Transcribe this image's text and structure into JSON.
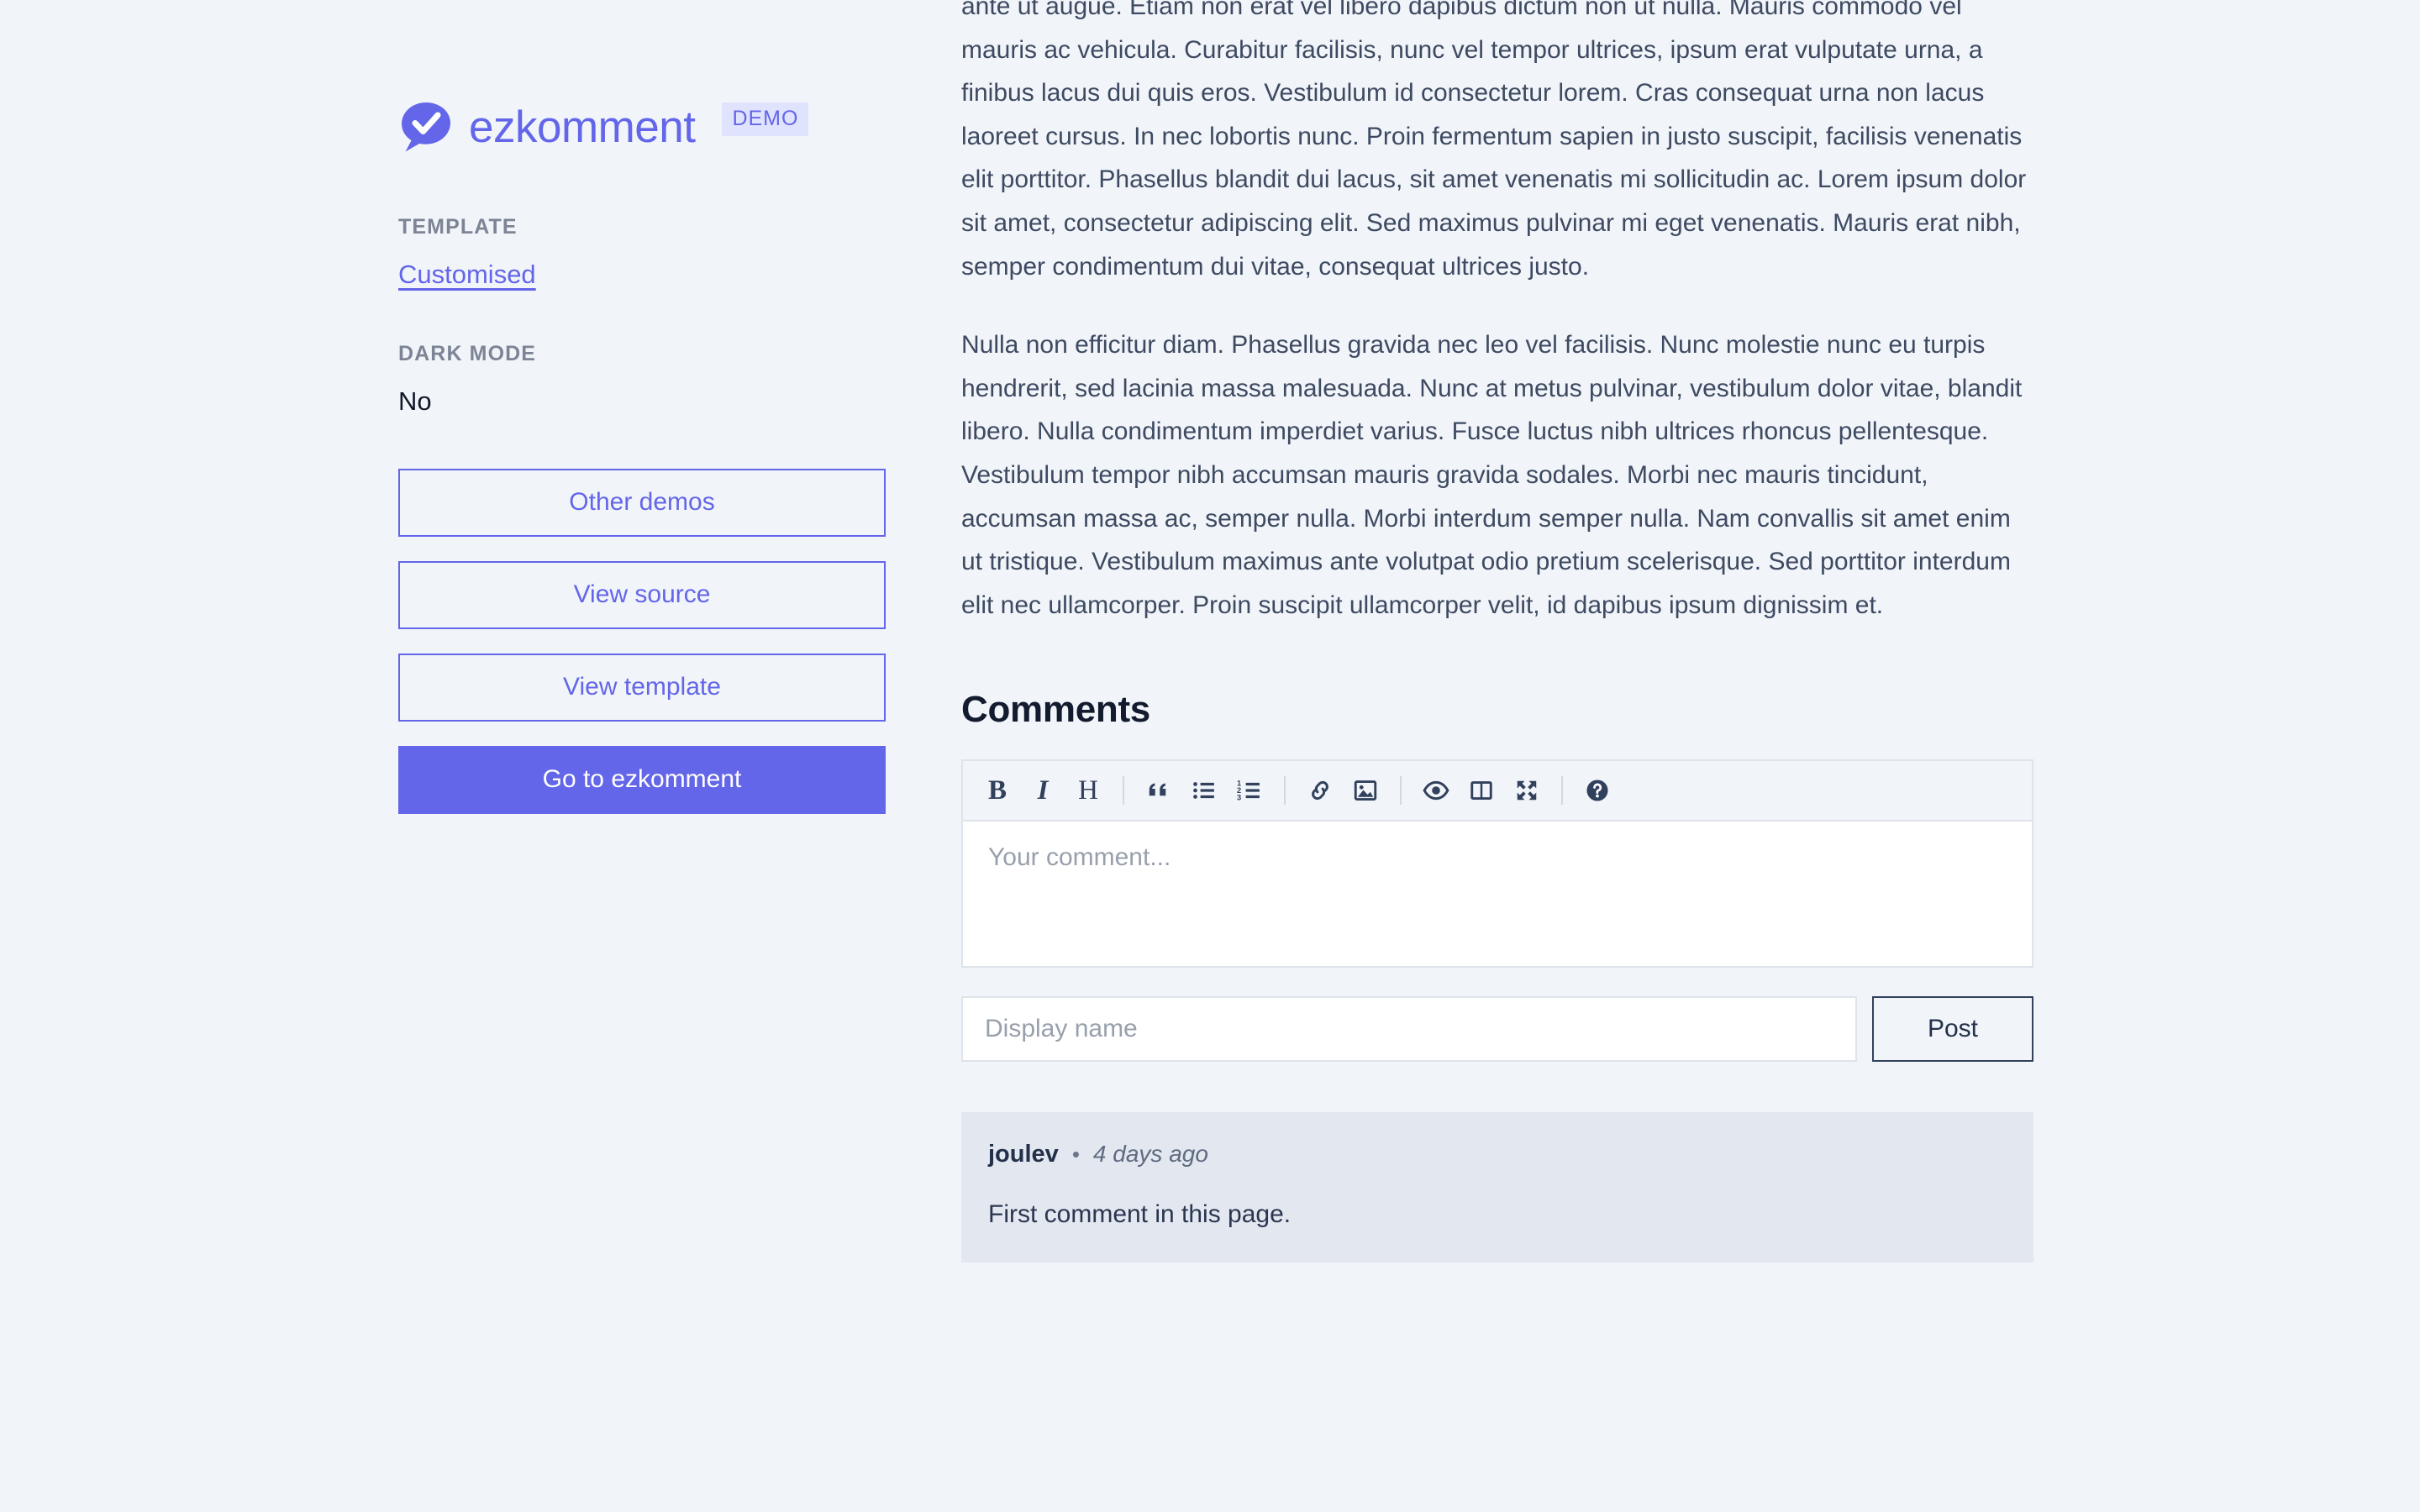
{
  "brand": {
    "name": "ezkomment",
    "badge": "DEMO",
    "logo_icon": "speech-bubble-check-icon",
    "accent_color": "#6366e8"
  },
  "sidebar": {
    "template_label": "TEMPLATE",
    "template_value": "Customised",
    "dark_mode_label": "DARK MODE",
    "dark_mode_value": "No",
    "buttons": [
      {
        "label": "Other demos",
        "style": "outline"
      },
      {
        "label": "View source",
        "style": "outline"
      },
      {
        "label": "View template",
        "style": "outline"
      },
      {
        "label": "Go to ezkomment",
        "style": "primary"
      }
    ]
  },
  "article": {
    "paragraphs": [
      "ante ut augue. Etiam non erat vel libero dapibus dictum non ut nulla. Mauris commodo vel mauris ac vehicula. Curabitur facilisis, nunc vel tempor ultrices, ipsum erat vulputate urna, a finibus lacus dui quis eros. Vestibulum id consectetur lorem. Cras consequat urna non lacus laoreet cursus. In nec lobortis nunc. Proin fermentum sapien in justo suscipit, facilisis venenatis elit porttitor. Phasellus blandit dui lacus, sit amet venenatis mi sollicitudin ac. Lorem ipsum dolor sit amet, consectetur adipiscing elit. Sed maximus pulvinar mi eget venenatis. Mauris erat nibh, semper condimentum dui vitae, consequat ultrices justo.",
      "Nulla non efficitur diam. Phasellus gravida nec leo vel facilisis. Nunc molestie nunc eu turpis hendrerit, sed lacinia massa malesuada. Nunc at metus pulvinar, vestibulum dolor vitae, blandit libero. Nulla condimentum imperdiet varius. Fusce luctus nibh ultrices rhoncus pellentesque. Vestibulum tempor nibh accumsan mauris gravida sodales. Morbi nec mauris tincidunt, accumsan massa ac, semper nulla. Morbi interdum semper nulla. Nam convallis sit amet enim ut tristique. Vestibulum maximus ante volutpat odio pretium scelerisque. Sed porttitor interdum elit nec ullamcorper. Proin suscipit ullamcorper velit, id dapibus ipsum dignissim et."
    ]
  },
  "comments_section": {
    "heading": "Comments",
    "toolbar": [
      {
        "name": "bold-icon",
        "glyph": "B"
      },
      {
        "name": "italic-icon",
        "glyph": "I"
      },
      {
        "name": "heading-icon",
        "glyph": "H"
      },
      {
        "name": "quote-icon",
        "glyph": "❝"
      },
      {
        "name": "unordered-list-icon",
        "glyph": ""
      },
      {
        "name": "ordered-list-icon",
        "glyph": ""
      },
      {
        "name": "link-icon",
        "glyph": ""
      },
      {
        "name": "image-icon",
        "glyph": ""
      },
      {
        "name": "preview-eye-icon",
        "glyph": ""
      },
      {
        "name": "side-by-side-icon",
        "glyph": ""
      },
      {
        "name": "fullscreen-icon",
        "glyph": ""
      },
      {
        "name": "guide-help-icon",
        "glyph": ""
      }
    ],
    "comment_placeholder": "Your comment...",
    "name_placeholder": "Display name",
    "post_label": "Post",
    "comments": [
      {
        "author": "joulev",
        "separator": "•",
        "time": "4 days ago",
        "body": "First comment in this page."
      }
    ]
  }
}
